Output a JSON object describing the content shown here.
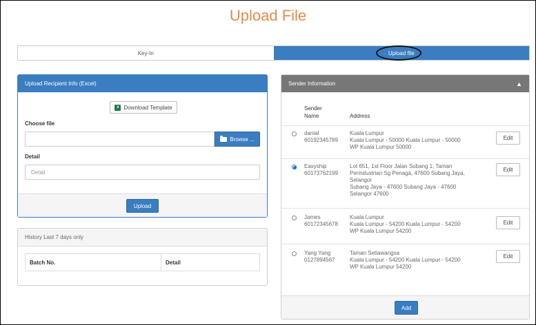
{
  "page": {
    "title": "Upload File"
  },
  "tabs": [
    {
      "label": "Key-In"
    },
    {
      "label": "Upload file"
    }
  ],
  "upload_panel": {
    "header": "Upload Recipient Info (Excel)",
    "download_template_label": "Download Template",
    "choose_file_label": "Choose file",
    "file_value": "",
    "browse_label": "Browse ...",
    "detail_label": "Detail",
    "detail_placeholder": "Detail",
    "upload_label": "Upload"
  },
  "history_panel": {
    "header": "History Last 7 days only",
    "columns": [
      "Batch No.",
      "Detail"
    ]
  },
  "sender_panel": {
    "header": "Sender Information",
    "col_name_1": "Sender",
    "col_name_2": "Name",
    "col_address": "Address",
    "edit_label": "Edit",
    "add_label": "Add",
    "rows": [
      {
        "name": "danial",
        "phone": "60192345789",
        "selected": false,
        "address": [
          "Kuala Lumpur",
          "Kuala Lumpur - 50000 Kuala Lumpur - 50000",
          "WP Kuala Lumpur 50000"
        ]
      },
      {
        "name": "Easyship",
        "phone": "60173762199",
        "selected": true,
        "address": [
          "Lot 651, 1st Floor Jalan Subang 1, Taman",
          "Perindustrian Sg Penaga, 47600 Subang Jaya,",
          "Selangor",
          "Subang Jaya - 47600 Subang Jaya - 47600",
          "Selangor 47600"
        ]
      },
      {
        "name": "James",
        "phone": "60172345678",
        "selected": false,
        "address": [
          "Kuala Lumpur",
          "Kuala Lumpur - 54200 Kuala Lumpur - 54200",
          "WP Kuala Lumpur 54200"
        ]
      },
      {
        "name": "Yang Yang",
        "phone": "0127894567",
        "selected": false,
        "address": [
          "Taman Setiawangsa",
          "Kuala Lumpur - 54200 Kuala Lumpur - 54200",
          "WP Kuala Lumpur 54200"
        ]
      }
    ]
  },
  "colors": {
    "accent_orange": "#e8894a",
    "primary_blue": "#3a7dc1",
    "header_grey": "#777777"
  }
}
